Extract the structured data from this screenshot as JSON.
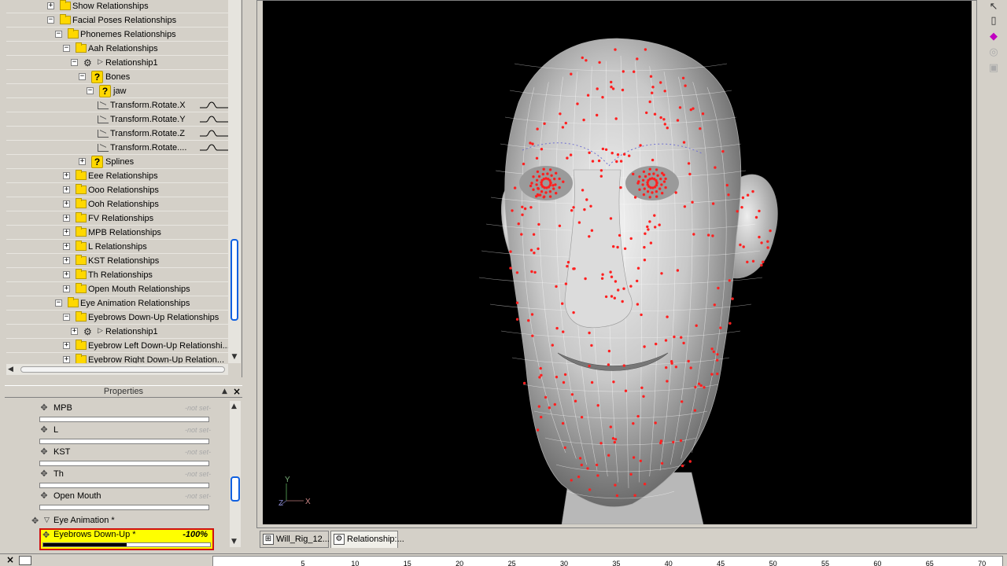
{
  "scene_tree": {
    "rows": [
      {
        "label": "Show Relationships",
        "expander": "+",
        "icon": "folder",
        "level": 5
      },
      {
        "label": "Facial Poses Relationships",
        "expander": "−",
        "icon": "folder",
        "level": 5
      },
      {
        "label": "Phonemes Relationships",
        "expander": "−",
        "icon": "folder",
        "level": 6
      },
      {
        "label": "Aah Relationships",
        "expander": "−",
        "icon": "folder",
        "level": 7
      },
      {
        "label": "Relationship1",
        "expander": "−",
        "icon": "relationship",
        "level": 8
      },
      {
        "label": "Bones",
        "expander": "−",
        "icon": "question",
        "level": 9
      },
      {
        "label": "jaw",
        "expander": "−",
        "icon": "question",
        "level": 10
      },
      {
        "label": "Transform.Rotate.X",
        "expander": "",
        "icon": "curve",
        "level": 11,
        "fcurve": true
      },
      {
        "label": "Transform.Rotate.Y",
        "expander": "",
        "icon": "curve",
        "level": 11,
        "fcurve": true
      },
      {
        "label": "Transform.Rotate.Z",
        "expander": "",
        "icon": "curve",
        "level": 11,
        "fcurve": true
      },
      {
        "label": "Transform.Rotate....",
        "expander": "",
        "icon": "curve",
        "level": 11,
        "fcurve": true
      },
      {
        "label": "Splines",
        "expander": "+",
        "icon": "question",
        "level": 9
      },
      {
        "label": "Eee Relationships",
        "expander": "+",
        "icon": "folder",
        "level": 7
      },
      {
        "label": "Ooo Relationships",
        "expander": "+",
        "icon": "folder",
        "level": 7
      },
      {
        "label": "Ooh Relationships",
        "expander": "+",
        "icon": "folder",
        "level": 7
      },
      {
        "label": "FV Relationships",
        "expander": "+",
        "icon": "folder",
        "level": 7
      },
      {
        "label": "MPB Relationships",
        "expander": "+",
        "icon": "folder",
        "level": 7
      },
      {
        "label": "L Relationships",
        "expander": "+",
        "icon": "folder",
        "level": 7
      },
      {
        "label": "KST Relationships",
        "expander": "+",
        "icon": "folder",
        "level": 7
      },
      {
        "label": "Th Relationships",
        "expander": "+",
        "icon": "folder",
        "level": 7
      },
      {
        "label": "Open Mouth Relationships",
        "expander": "+",
        "icon": "folder",
        "level": 7
      },
      {
        "label": "Eye Animation Relationships",
        "expander": "−",
        "icon": "folder",
        "level": 6
      },
      {
        "label": "Eyebrows Down-Up Relationships",
        "expander": "−",
        "icon": "folder",
        "level": 7
      },
      {
        "label": "Relationship1",
        "expander": "+",
        "icon": "relationship",
        "level": 8
      },
      {
        "label": "Eyebrow Left Down-Up Relationshi...",
        "expander": "+",
        "icon": "folder",
        "level": 7
      },
      {
        "label": "Eyebrow Right Down-Up Relation...",
        "expander": "+",
        "icon": "folder",
        "level": 7
      }
    ]
  },
  "properties": {
    "title": "Properties",
    "not_set_text": "-not set-",
    "items": [
      "MPB",
      "L",
      "KST",
      "Th",
      "Open Mouth"
    ],
    "group_label": "Eye Animation *",
    "selected": {
      "label": "Eyebrows Down-Up *",
      "value": "-100%",
      "fill_fraction": 0.5
    }
  },
  "viewport": {
    "axis_y": "Y",
    "axis_z": "Z",
    "axis_x": "X",
    "background": "#000000",
    "cp_color": "#ff2020"
  },
  "doc_tabs": [
    {
      "label": "Will_Rig_12...",
      "active": false
    },
    {
      "label": "Relationship:...",
      "active": true
    }
  ],
  "timeline": {
    "ticks": [
      "5",
      "10",
      "15",
      "20",
      "25",
      "30",
      "35",
      "40",
      "45",
      "50",
      "55",
      "60",
      "65",
      "70"
    ]
  }
}
